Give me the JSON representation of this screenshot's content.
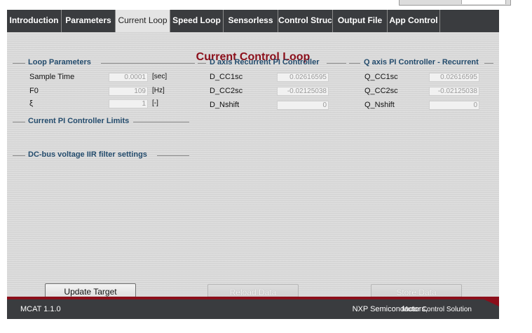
{
  "tabs": [
    {
      "label": "Introduction"
    },
    {
      "label": "Parameters"
    },
    {
      "label": "Current Loop",
      "active": true
    },
    {
      "label": "Speed Loop"
    },
    {
      "label": "Sensorless"
    },
    {
      "label": "Control Struc"
    },
    {
      "label": "Output File"
    },
    {
      "label": "App Control"
    }
  ],
  "page_title": "Current Control Loop",
  "loop_parameters": {
    "title": "Loop Parameters",
    "rows": [
      {
        "label": "Sample Time",
        "value": "0.0001",
        "unit": "[sec]"
      },
      {
        "label": "F0",
        "value": "109",
        "unit": "[Hz]"
      },
      {
        "label": "ξ",
        "value": "1",
        "unit": "[-]"
      }
    ]
  },
  "d_axis": {
    "title": "D axis Recurrent PI Controller",
    "rows": [
      {
        "label": "D_CC1sc",
        "value": "0.02616595"
      },
      {
        "label": "D_CC2sc",
        "value": "-0.02125038"
      },
      {
        "label": "D_Nshift",
        "value": "0"
      }
    ]
  },
  "q_axis": {
    "title": "Q axis PI Controller - Recurrent",
    "rows": [
      {
        "label": "Q_CC1sc",
        "value": "0.02616595"
      },
      {
        "label": "Q_CC2sc",
        "value": "-0.02125038"
      },
      {
        "label": "Q_Nshift",
        "value": "0"
      }
    ]
  },
  "limits_group": {
    "title": "Current PI Controller Limits"
  },
  "dcbus_group": {
    "title": "DC-bus voltage IIR filter settings"
  },
  "buttons": {
    "update": "Update Target",
    "reload": "Reload Data",
    "store": "Store Data"
  },
  "footer": {
    "version": "MCAT 1.1.0",
    "company": "NXP Semiconductors,",
    "tagline": "Motor Control Solution"
  },
  "colors": {
    "title_red": "#8b0e1a",
    "group_title_blue": "#234b6c",
    "bar_dark": "#3a3c3f"
  }
}
